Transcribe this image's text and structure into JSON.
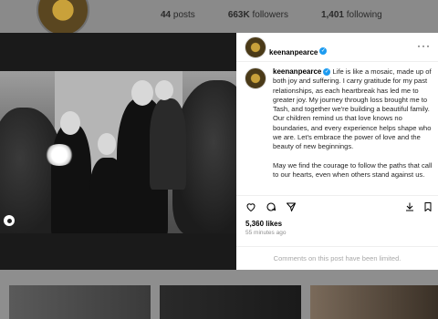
{
  "profile": {
    "posts_count": "44",
    "posts_label": "posts",
    "followers_count": "663K",
    "followers_label": "followers",
    "following_count": "1,401",
    "following_label": "following"
  },
  "post": {
    "username": "keenanpearce",
    "caption_paragraph_1": "Life is like a mosaic, made up of both joy and suffering. I carry gratitude for my past relationships, as each heartbreak has led me to greater joy. My journey through loss brought me to Tash, and together we're building a beautiful family. Our children remind us that love knows no boundaries, and every experience helps shape who we are. Let's embrace the power of love and the beauty of new beginnings.",
    "caption_paragraph_2": "May we find the courage to follow the paths that call to our hearts, even when others stand against us.",
    "likes": "5,360 likes",
    "time_ago": "55 minutes ago",
    "comments_notice": "Comments on this post have been limited."
  },
  "icons": [
    "like-icon",
    "comment-icon",
    "share-icon",
    "save-icon",
    "download-icon",
    "more-icon",
    "verified-icon",
    "tag-icon"
  ],
  "colors": {
    "verified": "#1d9bf0",
    "panel_bg": "#ffffff",
    "overlay": "#1a1a1a"
  }
}
